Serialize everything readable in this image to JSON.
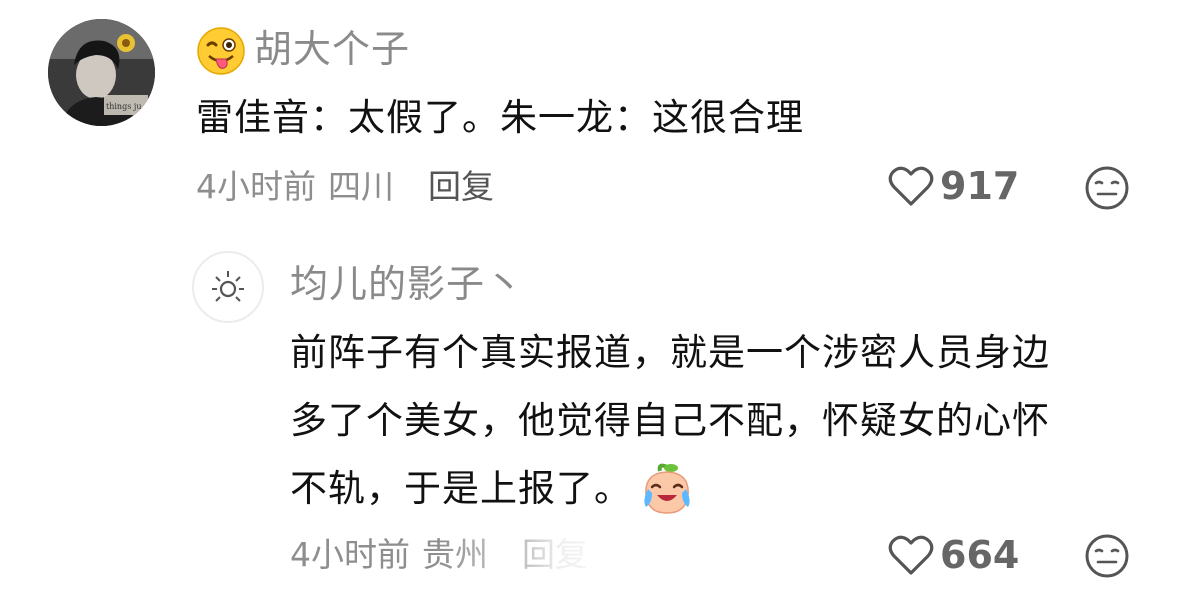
{
  "comment": {
    "username": "胡大个子",
    "text": "雷佳音：太假了。朱一龙：这很合理",
    "time": "4小时前",
    "location": "四川",
    "reply_label": "回复",
    "likes": "917",
    "avatar_caption": "things ju"
  },
  "reply": {
    "username": "均儿的影子丶",
    "text_line1": "前阵子有个真实报道，就是一个涉密人员身边",
    "text_line2": "多了个美女，他觉得自己不配，怀疑女的心怀",
    "text_line3": "不轨，于是上报了。",
    "time": "4小时前",
    "location": "贵州",
    "reply_label": "回复",
    "likes": "664"
  },
  "icons": {
    "main_avatar": "portrait-avatar",
    "reply_avatar": "sun-icon",
    "username_emoji": "winking-tongue-emoji",
    "reply_emoji": "crying-laughing-peach-emoji",
    "like": "heart-outline-icon",
    "dislike": "neutral-face-icon"
  },
  "colors": {
    "text_primary": "#111111",
    "text_secondary": "#8a8a8a",
    "reply_link": "#555555"
  }
}
